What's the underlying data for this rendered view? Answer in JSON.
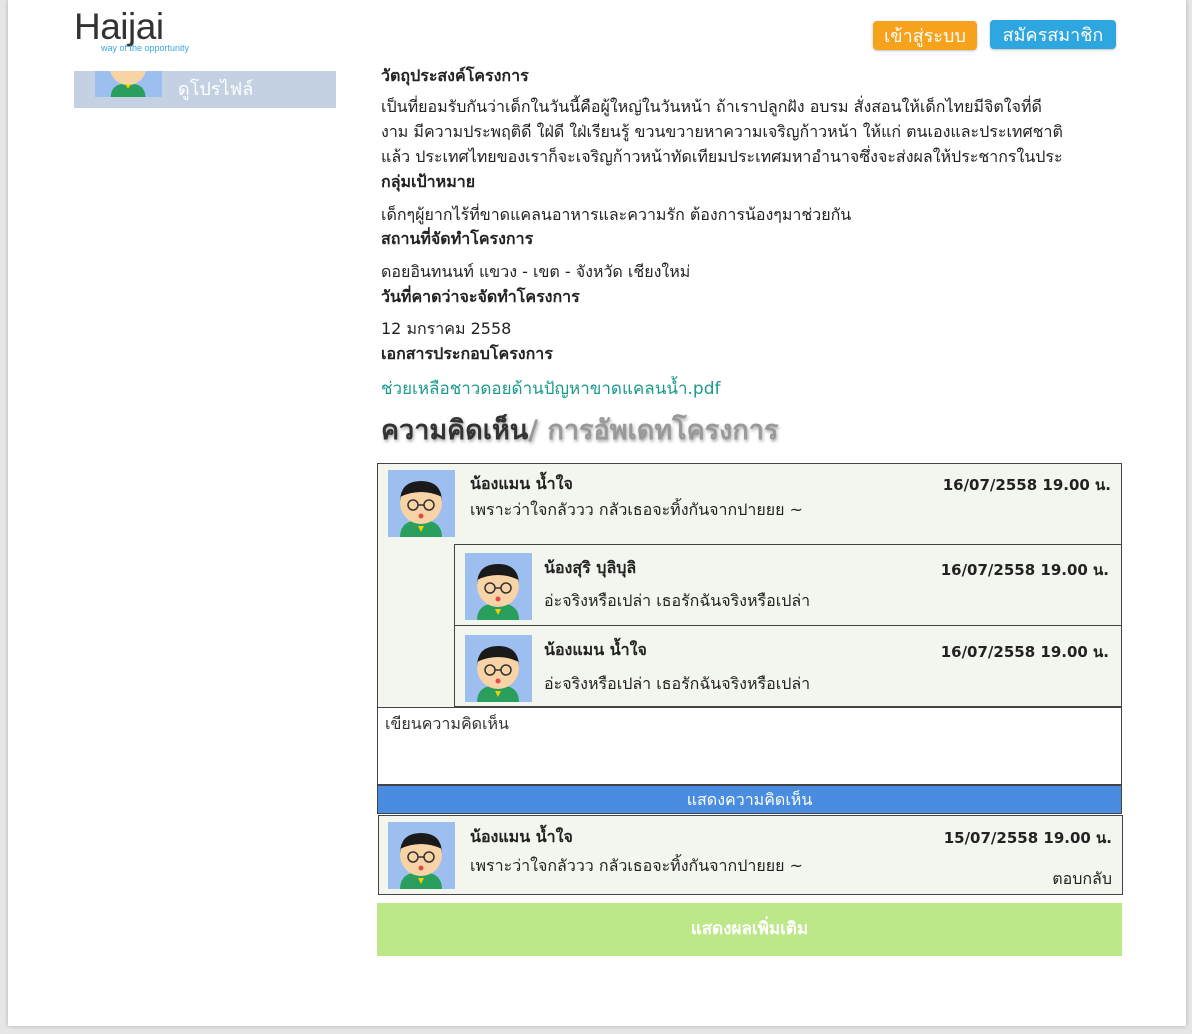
{
  "header": {
    "logo": "Haijai",
    "tagline": "way of the opportunity",
    "login_label": "เข้าสู่ระบบ",
    "register_label": "สมัครสมาชิก"
  },
  "sidebar": {
    "profile_link": "ดูโปรไฟล์"
  },
  "project": {
    "objective_heading": "วัตถุประสงค์โครงการ",
    "objective_lines": [
      "เป็นที่ยอมรับกันว่าเด็กในวันนี้คือผู้ใหญ่ในวันหน้า ถ้าเราปลูกฝัง อบรม สั่งสอนให้เด็กไทยมีจิตใจที่ดี",
      "งาม มีความประพฤติดี ใฝ่ดี ใฝ่เรียนรู้ ขวนขวายหาความเจริญก้าวหน้า ให้แก่ ตนเองและประเทศชาติ",
      "แล้ว ประเทศไทยของเราก็จะเจริญก้าวหน้าทัดเทียมประเทศมหาอำนาจซึ่งจะส่งผลให้ประชากรในประ"
    ],
    "target_heading": "กลุ่มเป้าหมาย",
    "target_text": "เด็กๆผู้ยากไร้ที่ขาดแคลนอาหารและความรัก ต้องการน้องๆมาช่วยกัน",
    "location_heading": "สถานที่จัดทำโครงการ",
    "location_text": "ดอยอินทนนท์ แขวง - เขต - จังหวัด เชียงใหม่",
    "date_heading": "วันที่คาดว่าจะจัดทำโครงการ",
    "date_text": "12 มกราคม 2558",
    "docs_heading": "เอกสารประกอบโครงการ",
    "doc_link": "ช่วยเหลือชาวดอยด้านปัญหาขาดแคลนน้ำ.pdf"
  },
  "comments_section": {
    "title_main": "ความคิดเห็น",
    "title_sub": "/ การอัพเดทโครงการ",
    "thread1": {
      "name": "น้องแมน น้ำใจ",
      "date": "16/07/2558 19.00 น.",
      "text": "เพราะว่าใจกลัววว กลัวเธอจะทิ้งกันจากปายยย ~"
    },
    "replies": [
      {
        "name": "น้องสุริ บุลิบุลิ",
        "date": "16/07/2558 19.00 น.",
        "text": "อ่ะจริงหรือเปล่า เธอรักฉันจริงหรือเปล่า"
      },
      {
        "name": "น้องแมน น้ำใจ",
        "date": "16/07/2558 19.00 น.",
        "text": "อ่ะจริงหรือเปล่า เธอรักฉันจริงหรือเปล่า"
      }
    ],
    "input_placeholder": "เขียนความคิดเห็น",
    "submit_label": "แสดงความคิดเห็น",
    "thread2": {
      "name": "น้องแมน น้ำใจ",
      "date": "15/07/2558 19.00 น.",
      "text": "เพราะว่าใจกลัววว กลัวเธอจะทิ้งกันจากปายยย ~",
      "reply_label": "ตอบกลับ"
    },
    "more_label": "แสดงผลเพิ่มเติม"
  }
}
